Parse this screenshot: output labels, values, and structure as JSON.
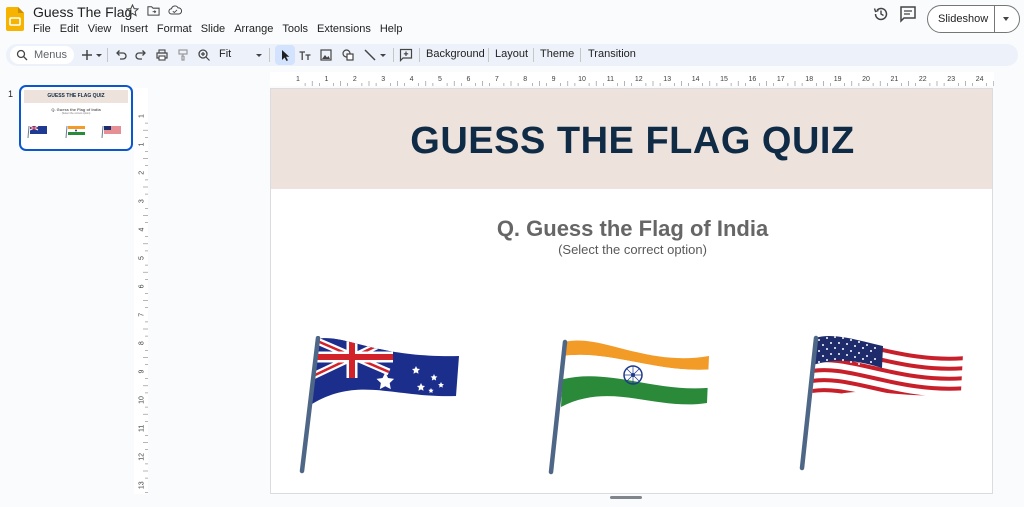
{
  "app": {
    "doc_title": "Guess The Flag",
    "menu": [
      "File",
      "Edit",
      "View",
      "Insert",
      "Format",
      "Slide",
      "Arrange",
      "Tools",
      "Extensions",
      "Help"
    ],
    "slideshow_label": "Slideshow",
    "accent": "#0b57d0"
  },
  "toolbar": {
    "menus_placeholder": "Menus",
    "zoom": "Fit",
    "background_label": "Background",
    "layout_label": "Layout",
    "theme_label": "Theme",
    "transition_label": "Transition"
  },
  "filmstrip": {
    "slide_number": "1"
  },
  "rulers": {
    "top": [
      "1",
      "1",
      "2",
      "3",
      "4",
      "5",
      "6",
      "7",
      "8",
      "9",
      "10",
      "11",
      "12",
      "13",
      "14",
      "15",
      "16",
      "17",
      "18",
      "19",
      "20",
      "21",
      "22",
      "23",
      "24",
      "25"
    ],
    "left": [
      "1",
      "1",
      "2",
      "3",
      "4",
      "5",
      "6",
      "7",
      "8",
      "9",
      "10",
      "11",
      "12",
      "13",
      "14"
    ]
  },
  "slide": {
    "title": "GUESS THE FLAG QUIZ",
    "question": "Q. Guess the Flag of India",
    "subtitle": "(Select the correct option)",
    "band_color": "#ede3dc",
    "title_color": "#0f2b46",
    "options": [
      {
        "name": "australia-flag"
      },
      {
        "name": "india-flag"
      },
      {
        "name": "usa-flag"
      }
    ]
  }
}
